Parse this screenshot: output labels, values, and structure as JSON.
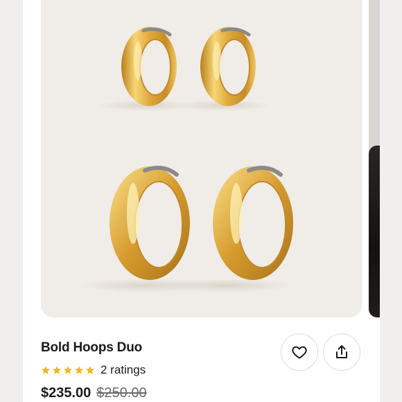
{
  "product": {
    "title": "Bold Hoops Duo",
    "rating_stars": 5,
    "rating_text": "2 ratings",
    "price": "$235.00",
    "original_price": "$250.00"
  },
  "actions": {
    "favorite_icon": "heart-icon",
    "share_icon": "share-icon"
  },
  "colors": {
    "image_bg": "#f0ece7",
    "gold": "#d9a437",
    "star": "#f2b71b",
    "text": "#1a1a1a"
  }
}
